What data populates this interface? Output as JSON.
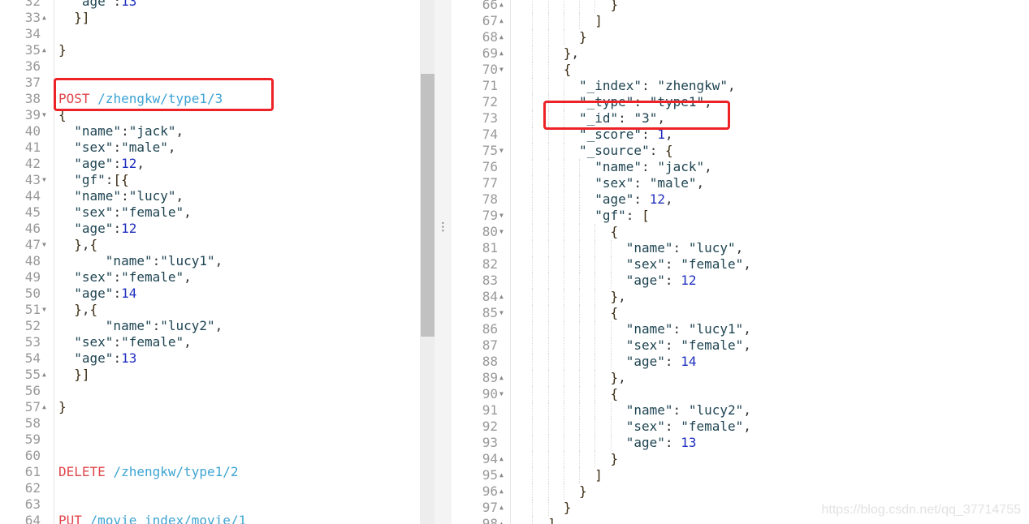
{
  "request_editor": {
    "lines": [
      {
        "n": "32",
        "fold": "",
        "text": "  \"age\":13"
      },
      {
        "n": "33",
        "fold": "up",
        "text": "  }]"
      },
      {
        "n": "34",
        "fold": "",
        "text": ""
      },
      {
        "n": "35",
        "fold": "up",
        "text": "}"
      },
      {
        "n": "36",
        "fold": "",
        "text": ""
      },
      {
        "n": "37",
        "fold": "",
        "text": ""
      },
      {
        "n": "38",
        "fold": "",
        "text": "POST /zhengkw/type1/3"
      },
      {
        "n": "39",
        "fold": "down",
        "text": "{"
      },
      {
        "n": "40",
        "fold": "",
        "text": "  \"name\":\"jack\","
      },
      {
        "n": "41",
        "fold": "",
        "text": "  \"sex\":\"male\","
      },
      {
        "n": "42",
        "fold": "",
        "text": "  \"age\":12,"
      },
      {
        "n": "43",
        "fold": "down",
        "text": "  \"gf\":[{"
      },
      {
        "n": "44",
        "fold": "",
        "text": "  \"name\":\"lucy\","
      },
      {
        "n": "45",
        "fold": "",
        "text": "  \"sex\":\"female\","
      },
      {
        "n": "46",
        "fold": "",
        "text": "  \"age\":12"
      },
      {
        "n": "47",
        "fold": "down",
        "text": "  },{"
      },
      {
        "n": "48",
        "fold": "",
        "text": "      \"name\":\"lucy1\","
      },
      {
        "n": "49",
        "fold": "",
        "text": "  \"sex\":\"female\","
      },
      {
        "n": "50",
        "fold": "",
        "text": "  \"age\":14"
      },
      {
        "n": "51",
        "fold": "down",
        "text": "  },{"
      },
      {
        "n": "52",
        "fold": "",
        "text": "      \"name\":\"lucy2\","
      },
      {
        "n": "53",
        "fold": "",
        "text": "  \"sex\":\"female\","
      },
      {
        "n": "54",
        "fold": "",
        "text": "  \"age\":13"
      },
      {
        "n": "55",
        "fold": "up",
        "text": "  }]"
      },
      {
        "n": "56",
        "fold": "",
        "text": ""
      },
      {
        "n": "57",
        "fold": "up",
        "text": "}"
      },
      {
        "n": "58",
        "fold": "",
        "text": ""
      },
      {
        "n": "59",
        "fold": "",
        "text": ""
      },
      {
        "n": "60",
        "fold": "",
        "text": ""
      },
      {
        "n": "61",
        "fold": "",
        "text": "DELETE /zhengkw/type1/2"
      },
      {
        "n": "62",
        "fold": "",
        "text": ""
      },
      {
        "n": "63",
        "fold": "",
        "text": ""
      },
      {
        "n": "64",
        "fold": "",
        "text": "PUT /movie_index/movie/1"
      }
    ]
  },
  "response_editor": {
    "lines": [
      {
        "n": "66",
        "fold": "up",
        "text": "            }"
      },
      {
        "n": "67",
        "fold": "up",
        "text": "          ]"
      },
      {
        "n": "68",
        "fold": "up",
        "text": "        }"
      },
      {
        "n": "69",
        "fold": "up",
        "text": "      },"
      },
      {
        "n": "70",
        "fold": "down",
        "text": "      {"
      },
      {
        "n": "71",
        "fold": "",
        "text": "        \"_index\": \"zhengkw\","
      },
      {
        "n": "72",
        "fold": "",
        "text": "        \"_type\": \"type1\","
      },
      {
        "n": "73",
        "fold": "",
        "text": "        \"_id\": \"3\","
      },
      {
        "n": "74",
        "fold": "",
        "text": "        \"_score\": 1,"
      },
      {
        "n": "75",
        "fold": "down",
        "text": "        \"_source\": {"
      },
      {
        "n": "76",
        "fold": "",
        "text": "          \"name\": \"jack\","
      },
      {
        "n": "77",
        "fold": "",
        "text": "          \"sex\": \"male\","
      },
      {
        "n": "78",
        "fold": "",
        "text": "          \"age\": 12,"
      },
      {
        "n": "79",
        "fold": "down",
        "text": "          \"gf\": ["
      },
      {
        "n": "80",
        "fold": "down",
        "text": "            {"
      },
      {
        "n": "81",
        "fold": "",
        "text": "              \"name\": \"lucy\","
      },
      {
        "n": "82",
        "fold": "",
        "text": "              \"sex\": \"female\","
      },
      {
        "n": "83",
        "fold": "",
        "text": "              \"age\": 12"
      },
      {
        "n": "84",
        "fold": "up",
        "text": "            },"
      },
      {
        "n": "85",
        "fold": "down",
        "text": "            {"
      },
      {
        "n": "86",
        "fold": "",
        "text": "              \"name\": \"lucy1\","
      },
      {
        "n": "87",
        "fold": "",
        "text": "              \"sex\": \"female\","
      },
      {
        "n": "88",
        "fold": "",
        "text": "              \"age\": 14"
      },
      {
        "n": "89",
        "fold": "up",
        "text": "            },"
      },
      {
        "n": "90",
        "fold": "down",
        "text": "            {"
      },
      {
        "n": "91",
        "fold": "",
        "text": "              \"name\": \"lucy2\","
      },
      {
        "n": "92",
        "fold": "",
        "text": "              \"sex\": \"female\","
      },
      {
        "n": "93",
        "fold": "",
        "text": "              \"age\": 13"
      },
      {
        "n": "94",
        "fold": "up",
        "text": "            }"
      },
      {
        "n": "95",
        "fold": "up",
        "text": "          ]"
      },
      {
        "n": "96",
        "fold": "up",
        "text": "        }"
      },
      {
        "n": "97",
        "fold": "up",
        "text": "      }"
      },
      {
        "n": "98",
        "fold": "up",
        "text": "    ]"
      }
    ]
  },
  "resizer": {
    "grip": "⋮"
  },
  "watermark": "https://blog.csdn.net/qq_37714755",
  "colors": {
    "highlight_box": "#ec2227",
    "method": "#e0474c",
    "url": "#3ea4d3",
    "number": "#1f2fbf",
    "string": "#1e4452"
  }
}
